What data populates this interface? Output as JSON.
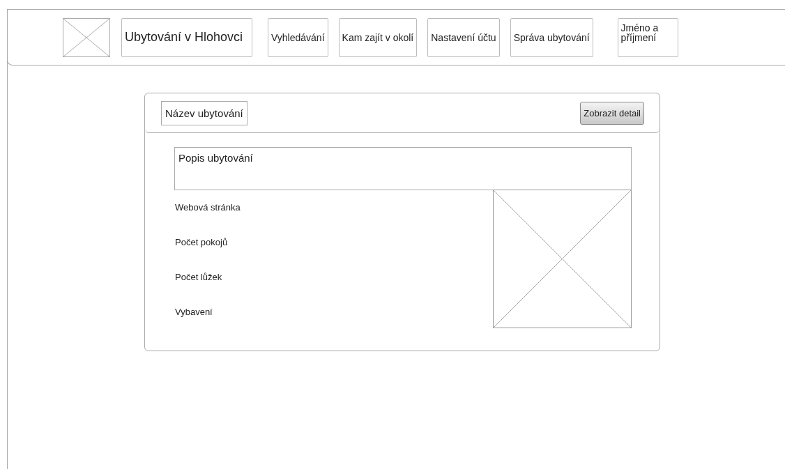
{
  "header": {
    "nav": [
      {
        "kind": "logo"
      },
      {
        "kind": "title",
        "label": "Ubytování v Hlohovci"
      },
      {
        "kind": "link",
        "label": "Vyhledávání"
      },
      {
        "kind": "link",
        "label": "Kam zajít v okolí"
      },
      {
        "kind": "link",
        "label": "Nastavení účtu"
      },
      {
        "kind": "link",
        "label": "Správa ubytování"
      },
      {
        "kind": "user",
        "label": "Jméno a příjmení"
      }
    ]
  },
  "card": {
    "name_field": "Název ubytování",
    "detail_button": "Zobrazit detail",
    "description": "Popis ubytování",
    "fields": [
      "Webová stránka",
      "Počet pokojů",
      "Počet lůžek",
      "Vybavení"
    ]
  }
}
